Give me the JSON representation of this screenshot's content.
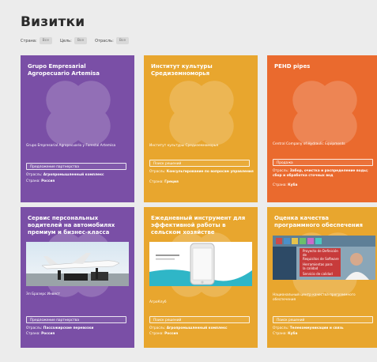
{
  "page": {
    "title": "Визитки"
  },
  "filters": [
    {
      "label": "Страна:",
      "value": "Все"
    },
    {
      "label": "Цель:",
      "value": "Все"
    },
    {
      "label": "Отрасль:",
      "value": "Все"
    }
  ],
  "labels": {
    "industry": "Отрасль:",
    "country": "Страна:"
  },
  "colors": {
    "purple": "#7a4fa6",
    "yellow": "#e8a62e",
    "orange": "#ea6a2e"
  },
  "cards": [
    {
      "title": "Grupo Empresarial Agropecuario Artemisa",
      "org": "Grupo Empresarial Agropecuario y Forestal Artemisa",
      "action": "Предложение партнерства",
      "industry": "Агропромышленный комплекс",
      "country": "Россия"
    },
    {
      "title": "Институт культуры Средиземноморья",
      "org": "Институт культуры Средиземноморья",
      "action": "Поиск решений",
      "industry": "Консультирование по вопросам управления",
      "country": "Греция"
    },
    {
      "title": "PEHD pipes",
      "org": "Central Company of Hydraulic Equipments",
      "action": "Продажа",
      "industry": "Забор, очистка и распределение воды; сбор и обработка сточных вод",
      "country": "Куба"
    },
    {
      "title": "Сервис персональных водителей на автомобилях премиум и бизнес-класса",
      "org": "Эл Бразерс Инвест",
      "action": "Предложение партнерства",
      "industry": "Пассажирские перевозки",
      "country": "Россия"
    },
    {
      "title": "Ежедневный инструмент для эффективной работы в сельском хозяйстве",
      "org": "АгроКлуб",
      "action": "Поиск решений",
      "industry": "Агропромышленный комплекс",
      "country": "Россия"
    },
    {
      "title": "Оценка качества программного обеспечения",
      "org": "Национальный центр качества программного обеспечения",
      "action": "Поиск решений",
      "industry": "Телекоммуникации и связь",
      "country": "Куба",
      "image_lines": [
        "Proyecto de Definición de",
        "Requisitos de Software",
        "Herramientas para",
        "la calidad",
        "Servicio de calidad"
      ]
    }
  ]
}
